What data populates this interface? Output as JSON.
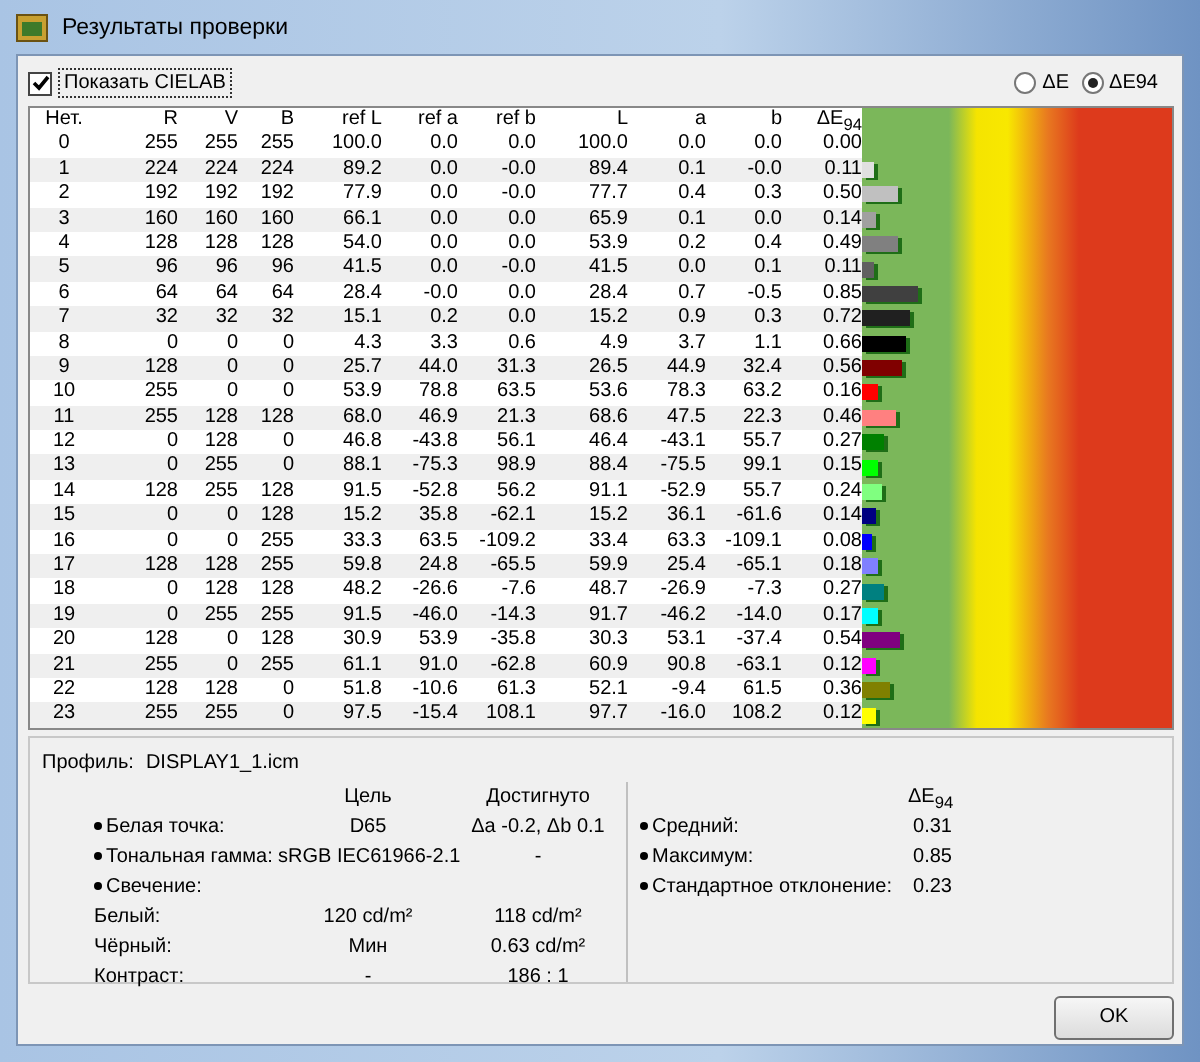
{
  "window": {
    "title": "Результаты проверки"
  },
  "show_cielab": {
    "label": "Показать CIELAB",
    "checked": true
  },
  "mode_options": [
    {
      "label": "ΔE",
      "selected": false
    },
    {
      "label": "ΔE94",
      "selected": true
    }
  ],
  "table": {
    "columns": [
      "Нет.",
      "R",
      "V",
      "B",
      "ref L",
      "ref a",
      "ref b",
      "L",
      "a",
      "b",
      "ΔE$_{94}$"
    ],
    "rows": [
      {
        "cells": [
          "0",
          "255",
          "255",
          "255",
          "100.0",
          "0.0",
          "0.0",
          "100.0",
          "0.0",
          "0.0",
          "0.00"
        ]
      },
      {
        "cells": [
          "1",
          "224",
          "224",
          "224",
          "89.2",
          "0.0",
          "-0.0",
          "89.4",
          "0.1",
          "-0.0",
          "0.11"
        ],
        "color": "#e0e0e0",
        "level": 0.04
      },
      {
        "cells": [
          "2",
          "192",
          "192",
          "192",
          "77.9",
          "0.0",
          "-0.0",
          "77.7",
          "0.4",
          "0.3",
          "0.50"
        ],
        "color": "#c0c0c0",
        "level": 0.115
      },
      {
        "cells": [
          "3",
          "160",
          "160",
          "160",
          "66.1",
          "0.0",
          "0.0",
          "65.9",
          "0.1",
          "0.0",
          "0.14"
        ],
        "color": "#a0a0a0",
        "level": 0.047
      },
      {
        "cells": [
          "4",
          "128",
          "128",
          "128",
          "54.0",
          "0.0",
          "0.0",
          "53.9",
          "0.2",
          "0.4",
          "0.49"
        ],
        "color": "#808080",
        "level": 0.113
      },
      {
        "cells": [
          "5",
          "96",
          "96",
          "96",
          "41.5",
          "0.0",
          "-0.0",
          "41.5",
          "0.0",
          "0.1",
          "0.11"
        ],
        "color": "#606060",
        "level": 0.04
      },
      {
        "cells": [
          "6",
          "64",
          "64",
          "64",
          "28.4",
          "-0.0",
          "0.0",
          "28.4",
          "0.7",
          "-0.5",
          "0.85"
        ],
        "color": "#404040",
        "level": 0.18
      },
      {
        "cells": [
          "7",
          "32",
          "32",
          "32",
          "15.1",
          "0.2",
          "0.0",
          "15.2",
          "0.9",
          "0.3",
          "0.72"
        ],
        "color": "#202020",
        "level": 0.157
      },
      {
        "cells": [
          "8",
          "0",
          "0",
          "0",
          "4.3",
          "3.3",
          "0.6",
          "4.9",
          "3.7",
          "1.1",
          "0.66"
        ],
        "color": "#000000",
        "level": 0.145
      },
      {
        "cells": [
          "9",
          "128",
          "0",
          "0",
          "25.7",
          "44.0",
          "31.3",
          "26.5",
          "44.9",
          "32.4",
          "0.56"
        ],
        "color": "#800000",
        "level": 0.126
      },
      {
        "cells": [
          "10",
          "255",
          "0",
          "0",
          "53.9",
          "78.8",
          "63.5",
          "53.6",
          "78.3",
          "63.2",
          "0.16"
        ],
        "color": "#ff0000",
        "level": 0.05
      },
      {
        "cells": [
          "11",
          "255",
          "128",
          "128",
          "68.0",
          "46.9",
          "21.3",
          "68.6",
          "47.5",
          "22.3",
          "0.46"
        ],
        "color": "#ff8080",
        "level": 0.107
      },
      {
        "cells": [
          "12",
          "0",
          "128",
          "0",
          "46.8",
          "-43.8",
          "56.1",
          "46.4",
          "-43.1",
          "55.7",
          "0.27"
        ],
        "color": "#008000",
        "level": 0.071
      },
      {
        "cells": [
          "13",
          "0",
          "255",
          "0",
          "88.1",
          "-75.3",
          "98.9",
          "88.4",
          "-75.5",
          "99.1",
          "0.15"
        ],
        "color": "#00ff00",
        "level": 0.049
      },
      {
        "cells": [
          "14",
          "128",
          "255",
          "128",
          "91.5",
          "-52.8",
          "56.2",
          "91.1",
          "-52.9",
          "55.7",
          "0.24"
        ],
        "color": "#80ff80",
        "level": 0.066
      },
      {
        "cells": [
          "15",
          "0",
          "0",
          "128",
          "15.2",
          "35.8",
          "-62.1",
          "15.2",
          "36.1",
          "-61.6",
          "0.14"
        ],
        "color": "#000080",
        "level": 0.047
      },
      {
        "cells": [
          "16",
          "0",
          "0",
          "255",
          "33.3",
          "63.5",
          "-109.2",
          "33.4",
          "63.3",
          "-109.1",
          "0.08"
        ],
        "color": "#0000ff",
        "level": 0.035
      },
      {
        "cells": [
          "17",
          "128",
          "128",
          "255",
          "59.8",
          "24.8",
          "-65.5",
          "59.9",
          "25.4",
          "-65.1",
          "0.18"
        ],
        "color": "#8080ff",
        "level": 0.054
      },
      {
        "cells": [
          "18",
          "0",
          "128",
          "128",
          "48.2",
          "-26.6",
          "-7.6",
          "48.7",
          "-26.9",
          "-7.3",
          "0.27"
        ],
        "color": "#008080",
        "level": 0.071
      },
      {
        "cells": [
          "19",
          "0",
          "255",
          "255",
          "91.5",
          "-46.0",
          "-14.3",
          "91.7",
          "-46.2",
          "-14.0",
          "0.17"
        ],
        "color": "#00ffff",
        "level": 0.052
      },
      {
        "cells": [
          "20",
          "128",
          "0",
          "128",
          "30.9",
          "53.9",
          "-35.8",
          "30.3",
          "53.1",
          "-37.4",
          "0.54"
        ],
        "color": "#800080",
        "level": 0.123
      },
      {
        "cells": [
          "21",
          "255",
          "0",
          "255",
          "61.1",
          "91.0",
          "-62.8",
          "60.9",
          "90.8",
          "-63.1",
          "0.12"
        ],
        "color": "#ff00ff",
        "level": 0.043
      },
      {
        "cells": [
          "22",
          "128",
          "128",
          "0",
          "51.8",
          "-10.6",
          "61.3",
          "52.1",
          "-9.4",
          "61.5",
          "0.36"
        ],
        "color": "#808000",
        "level": 0.088
      },
      {
        "cells": [
          "23",
          "255",
          "255",
          "0",
          "97.5",
          "-15.4",
          "108.1",
          "97.7",
          "-16.0",
          "108.2",
          "0.12"
        ],
        "color": "#ffff00",
        "level": 0.043
      }
    ]
  },
  "profile": {
    "label": "Профиль:",
    "value": "DISPLAY1_1.icm"
  },
  "targets": {
    "columns": [
      "Цель",
      "Достигнуто"
    ],
    "rows": [
      {
        "label": "Белая точка:",
        "bulleted": true,
        "target": "D65",
        "achieved": "Δa -0.2, Δb 0.1"
      },
      {
        "label": "Тональная гамма:",
        "bulleted": true,
        "target": "sRGB IEC61966-2.1",
        "achieved": "-"
      },
      {
        "label": "Свечение:",
        "bulleted": true
      },
      {
        "label": "Белый:",
        "bulleted": false,
        "target": "120 cd/m²",
        "achieved": "118 cd/m²"
      },
      {
        "label": "Чёрный:",
        "bulleted": false,
        "target": "Мин",
        "achieved": "0.63 cd/m²"
      },
      {
        "label": "Контраст:",
        "bulleted": false,
        "target": "-",
        "achieved": "186 : 1"
      }
    ]
  },
  "stats": {
    "header": "ΔE$_{94}$",
    "rows": [
      {
        "label": "Средний:",
        "bulleted": true,
        "value": "0.31"
      },
      {
        "label": "Максимум:",
        "bulleted": true,
        "value": "0.85"
      },
      {
        "label": "Стандартное отклонение:",
        "bulleted": true,
        "value": "0.23"
      }
    ]
  },
  "buttons": [
    "OK"
  ]
}
